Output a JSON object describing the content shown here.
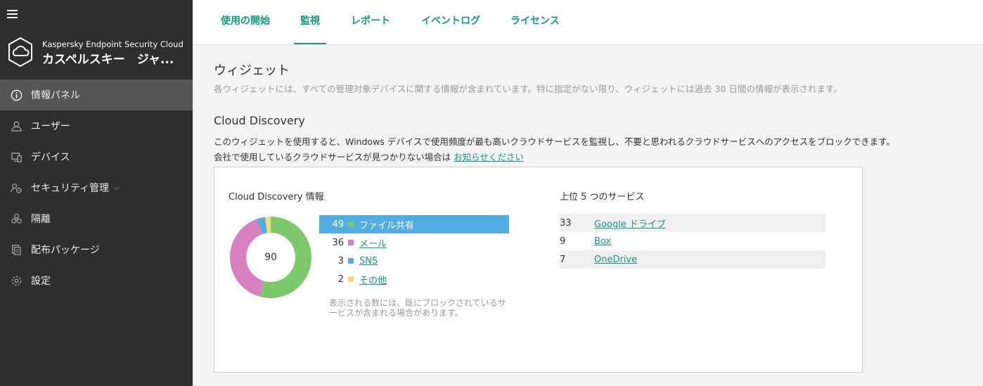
{
  "sidebar": {
    "brand_sub": "Kaspersky Endpoint Security Cloud",
    "brand_title": "カスペルスキー　ジャ...",
    "items": [
      {
        "label": "情報パネル",
        "icon": "info-icon"
      },
      {
        "label": "ユーザー",
        "icon": "user-icon"
      },
      {
        "label": "デバイス",
        "icon": "device-icon"
      },
      {
        "label": "セキュリティ管理",
        "icon": "security-icon"
      },
      {
        "label": "隔離",
        "icon": "biohazard-icon"
      },
      {
        "label": "配布パッケージ",
        "icon": "package-icon"
      },
      {
        "label": "設定",
        "icon": "gear-icon"
      }
    ],
    "active_index": 0
  },
  "tabs": [
    "使用の開始",
    "監視",
    "レポート",
    "イベントログ",
    "ライセンス"
  ],
  "active_tab": 1,
  "page": {
    "title": "ウィジェット",
    "description": "各ウィジェットには、すべての管理対象デバイスに関する情報が含まれています。特に指定がない限り、ウィジェットには過去 30 日間の情報が表示されます。"
  },
  "widget": {
    "title": "Cloud Discovery",
    "desc_line1": "このウィジェットを使用すると、Windows デバイスで使用頻度が最も高いクラウドサービスを監視し、不要と思われるクラウドサービスへのアクセスをブロックできます。",
    "desc_line2_prefix": "会社で使用しているクラウドサービスが見つかりない場合は ",
    "desc_line2_link": "お知らせください",
    "info_heading": "Cloud Discovery 情報",
    "top_heading": "上位 5 つのサービス",
    "total": "90",
    "note": "表示される数には、既にブロックされているサービスが含まれる場合があります。"
  },
  "chart_data": {
    "type": "pie",
    "total": 90,
    "categories": [
      "ファイル共有",
      "メール",
      "SNS",
      "その他"
    ],
    "values": [
      49,
      36,
      3,
      2
    ],
    "colors": [
      "#7cc96c",
      "#d97fc0",
      "#52ade0",
      "#f2dc77"
    ]
  },
  "top_services": [
    {
      "count": "33",
      "name": "Google ドライブ"
    },
    {
      "count": "9",
      "name": "Box"
    },
    {
      "count": "7",
      "name": "OneDrive"
    }
  ]
}
